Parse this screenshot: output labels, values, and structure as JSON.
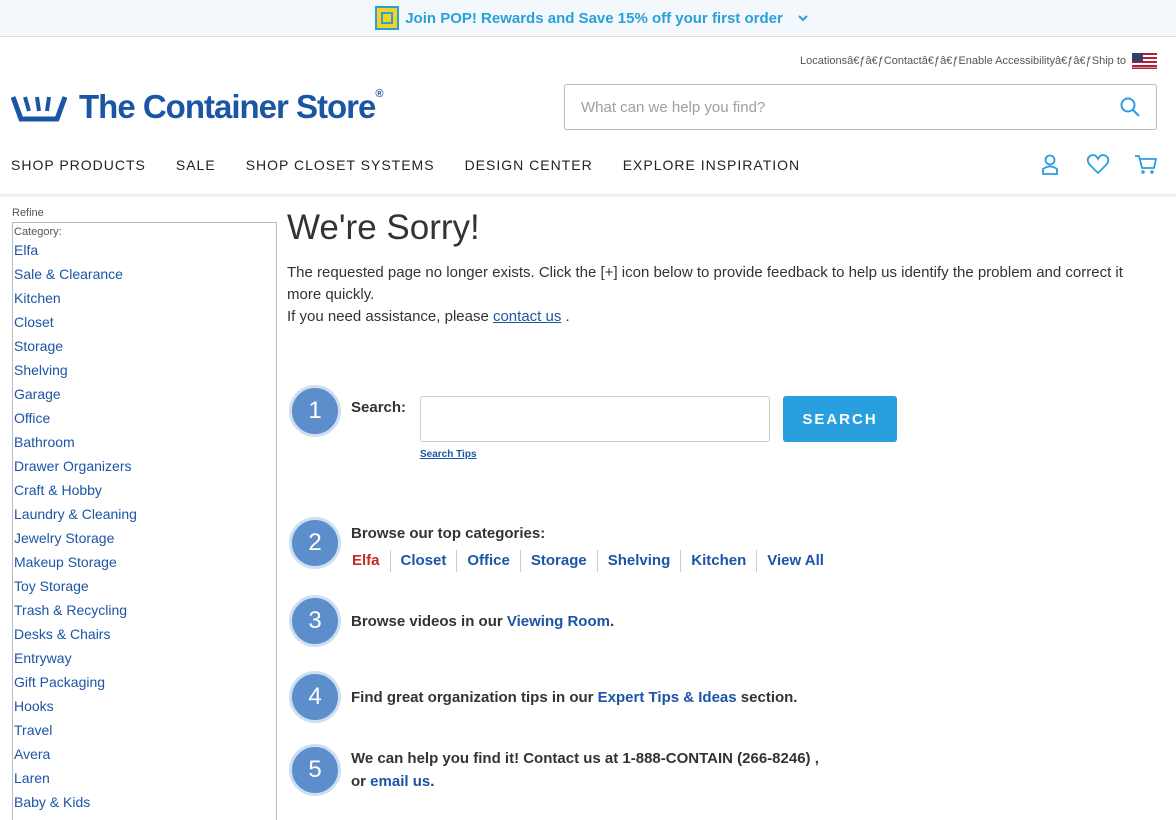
{
  "promo": {
    "text": "Join POP! Rewards and Save 15% off your first order"
  },
  "utility": {
    "text": "Locationsâ€ƒâ€ƒContactâ€ƒâ€ƒEnable Accessibilityâ€ƒâ€ƒShip to"
  },
  "logo": {
    "text": "The Container Store",
    "reg": "®"
  },
  "search": {
    "placeholder": "What can we help you find?"
  },
  "nav": [
    "SHOP PRODUCTS",
    "SALE",
    "SHOP CLOSET SYSTEMS",
    "DESIGN CENTER",
    "EXPLORE INSPIRATION"
  ],
  "sidebar": {
    "refine": "Refine",
    "category_label": "Category:",
    "categories": [
      "Elfa",
      "Sale & Clearance",
      "Kitchen",
      "Closet",
      "Storage",
      "Shelving",
      "Garage",
      "Office",
      "Bathroom",
      "Drawer Organizers",
      "Craft & Hobby",
      "Laundry & Cleaning",
      "Jewelry Storage",
      "Makeup Storage",
      "Toy Storage",
      "Trash & Recycling",
      "Desks & Chairs",
      "Entryway",
      "Gift Packaging",
      "Hooks",
      "Travel",
      "Avera",
      "Laren",
      "Baby & Kids"
    ]
  },
  "main": {
    "title": "We're Sorry!",
    "message": "The requested page no longer exists. Click the [+] icon below to provide feedback to help us identify the problem and correct it more quickly.",
    "assist_prefix": "If you need assistance, please",
    "assist_link": "contact us",
    "assist_suffix": " ."
  },
  "steps": {
    "s1": {
      "num": "1",
      "label": "Search:",
      "tips": "Search Tips",
      "button": "SEARCH"
    },
    "s2": {
      "num": "2",
      "label": "Browse our top categories:",
      "links": [
        "Elfa",
        "Closet",
        "Office",
        "Storage",
        "Shelving",
        "Kitchen",
        "View All"
      ]
    },
    "s3": {
      "num": "3",
      "prefix": "Browse videos in our ",
      "link": "Viewing Room",
      "suffix": "."
    },
    "s4": {
      "num": "4",
      "prefix": "Find great organization tips in our ",
      "link": "Expert Tips & Ideas",
      "suffix": " section."
    },
    "s5": {
      "num": "5",
      "line1": "We can help you find it!  Contact us at 1-888-CONTAIN (266-8246) ,",
      "prefix": "or ",
      "link": "email us",
      "suffix": "."
    }
  },
  "colors": {
    "brand_blue": "#1b55a5",
    "promo_blue": "#2aa0d9",
    "step_blue": "#5c8ecb",
    "search_button": "#2a9fe0",
    "elfa_red": "#c62828"
  },
  "icons": [
    "pop-rewards-icon",
    "chevron-down-icon",
    "us-flag-icon",
    "container-store-logo-icon",
    "search-icon",
    "account-icon",
    "heart-icon",
    "cart-icon"
  ]
}
